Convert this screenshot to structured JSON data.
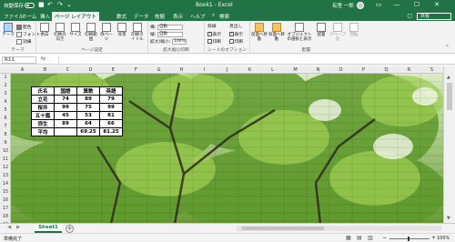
{
  "titlebar": {
    "autosave_label": "自動保存",
    "autosave_state": "オフ",
    "doc_title": "Book1 - Excel",
    "user_name": "有里 一郎",
    "undo_icon": "↶",
    "redo_icon": "↷",
    "save_icon": "■",
    "customize_icon": "⌄",
    "ribbon_display_icon": "▭",
    "minimize_icon": "—",
    "maximize_icon": "☐",
    "close_icon": "✕"
  },
  "tabs": [
    {
      "label": "ファイル",
      "active": false
    },
    {
      "label": "ホーム",
      "active": false
    },
    {
      "label": "挿入",
      "active": false
    },
    {
      "label": "ページ レイアウト",
      "active": true
    },
    {
      "label": "数式",
      "active": false
    },
    {
      "label": "データ",
      "active": false
    },
    {
      "label": "校閲",
      "active": false
    },
    {
      "label": "表示",
      "active": false
    },
    {
      "label": "ヘルプ",
      "active": false
    },
    {
      "label": "検索",
      "active": false
    }
  ],
  "share_label": "共有",
  "comment_label": "コメント",
  "ribbon": {
    "theme_group": {
      "label": "テーマ",
      "theme_button": "テーマ",
      "colors": "配色",
      "fonts": "フォント",
      "effects": "効果"
    },
    "page_setup_group": {
      "label": "ページ設定",
      "buttons": [
        "余白",
        "印刷の向き",
        "サイズ",
        "印刷範囲",
        "改ページ",
        "背景",
        "印刷タイトル"
      ]
    },
    "scale_group": {
      "label": "拡大縮小印刷",
      "width_label": "横:",
      "width_value": "自動",
      "height_label": "縦:",
      "height_value": "自動",
      "scale_label": "拡大/縮小:",
      "scale_value": "100%"
    },
    "sheet_options_group": {
      "label": "シートのオプション",
      "gridlines": "枠線",
      "headings": "見出し",
      "view": "表示",
      "print": "印刷",
      "gridlines_view": true,
      "gridlines_print": false,
      "headings_view": true,
      "headings_print": false
    },
    "arrange_group": {
      "label": "配置",
      "buttons": [
        "前面へ移動",
        "背面へ移動",
        "オブジェクトの選択と表示",
        "配置",
        "グループ化",
        "回転"
      ]
    }
  },
  "formula_bar": {
    "name_box": "R11",
    "fx_label": "fx",
    "formula": ""
  },
  "columns": [
    "A",
    "B",
    "C",
    "D",
    "E",
    "F",
    "G",
    "H",
    "I",
    "J",
    "K",
    "L",
    "M",
    "N",
    "O",
    "P",
    "Q",
    "R",
    "S"
  ],
  "rows": [
    "1",
    "2",
    "3",
    "4",
    "5",
    "6",
    "7",
    "8",
    "9",
    "10",
    "11",
    "12",
    "13",
    "14",
    "15",
    "16",
    "17",
    "18",
    "19"
  ],
  "table": {
    "headers": [
      "氏名",
      "国語",
      "算数",
      "英語"
    ],
    "rows": [
      [
        "立花",
        "74",
        "89",
        "79"
      ],
      [
        "桜井",
        "99",
        "75",
        "99"
      ],
      [
        "五十嵐",
        "45",
        "53",
        "81"
      ],
      [
        "弥生",
        "89",
        "64",
        "66"
      ],
      [
        "平均",
        "",
        "69.25",
        "81.25"
      ]
    ]
  },
  "sheet_tabs": [
    "Sheet1"
  ],
  "add_sheet_icon": "+",
  "status": {
    "ready_text": "準備完了",
    "zoom": "100%",
    "zoom_minus": "−",
    "zoom_plus": "+"
  }
}
